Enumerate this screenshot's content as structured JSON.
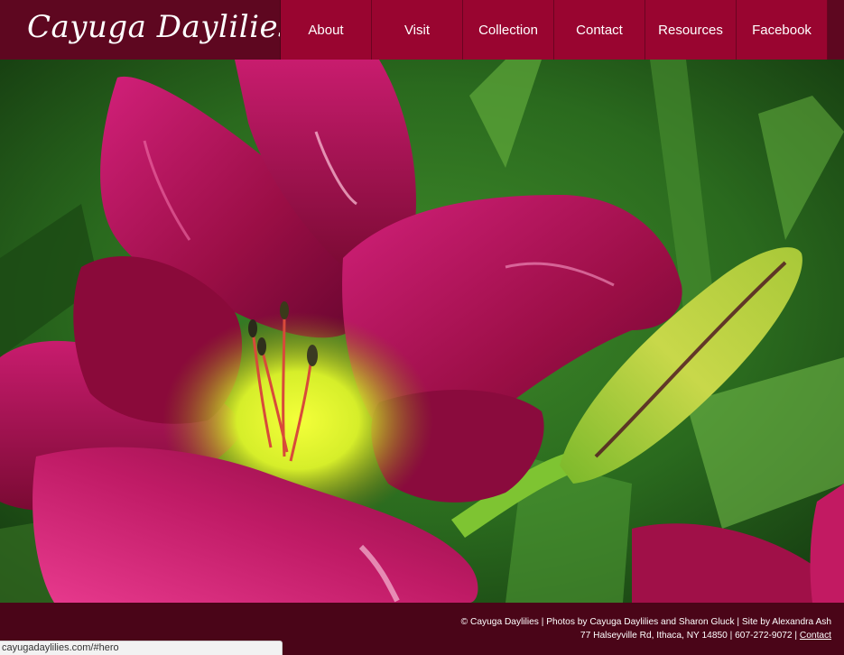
{
  "header": {
    "logo_text": "Cayuga Daylilies",
    "nav": [
      {
        "label": "About"
      },
      {
        "label": "Visit"
      },
      {
        "label": "Collection"
      },
      {
        "label": "Contact"
      },
      {
        "label": "Resources"
      },
      {
        "label": "Facebook"
      }
    ]
  },
  "hero": {
    "image_name": "daylily-photo"
  },
  "footer": {
    "line1": "© Cayuga Daylilies | Photos by Cayuga Daylilies and Sharon Gluck | Site by Alexandra Ash",
    "line2_text": "77 Halseyville Rd, Ithaca, NY 14850 | 607-272-9072 | ",
    "line2_link": "Contact"
  },
  "status_bar": {
    "url": "cayugadaylilies.com/#hero"
  },
  "colors": {
    "header_bg": "#5e0720",
    "nav_bg": "#990530",
    "footer_bg": "#4a0518"
  }
}
